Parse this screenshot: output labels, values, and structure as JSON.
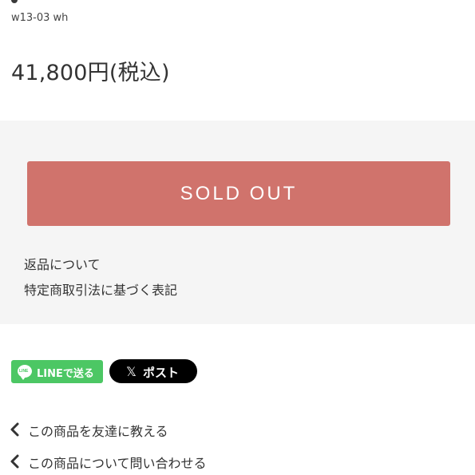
{
  "product": {
    "code": "w13-03 wh",
    "price": "41,800円(税込)"
  },
  "purchase": {
    "soldout_label": "SOLD OUT",
    "info_links": [
      "返品について",
      "特定商取引法に基づく表記"
    ]
  },
  "share": {
    "line_label": "LINEで送る",
    "x_glyph": "𝕏",
    "x_label": "ポスト",
    "line_icon_text": "LINE"
  },
  "actions": [
    {
      "label": "この商品を友達に教える",
      "icon": "chevron-left-icon"
    },
    {
      "label": "この商品について問い合わせる",
      "icon": "chevron-left-icon"
    }
  ],
  "colors": {
    "soldout_bg": "#d0736c",
    "panel_bg": "#f5f5f5",
    "line_green": "#4cc764",
    "x_black": "#000000"
  }
}
